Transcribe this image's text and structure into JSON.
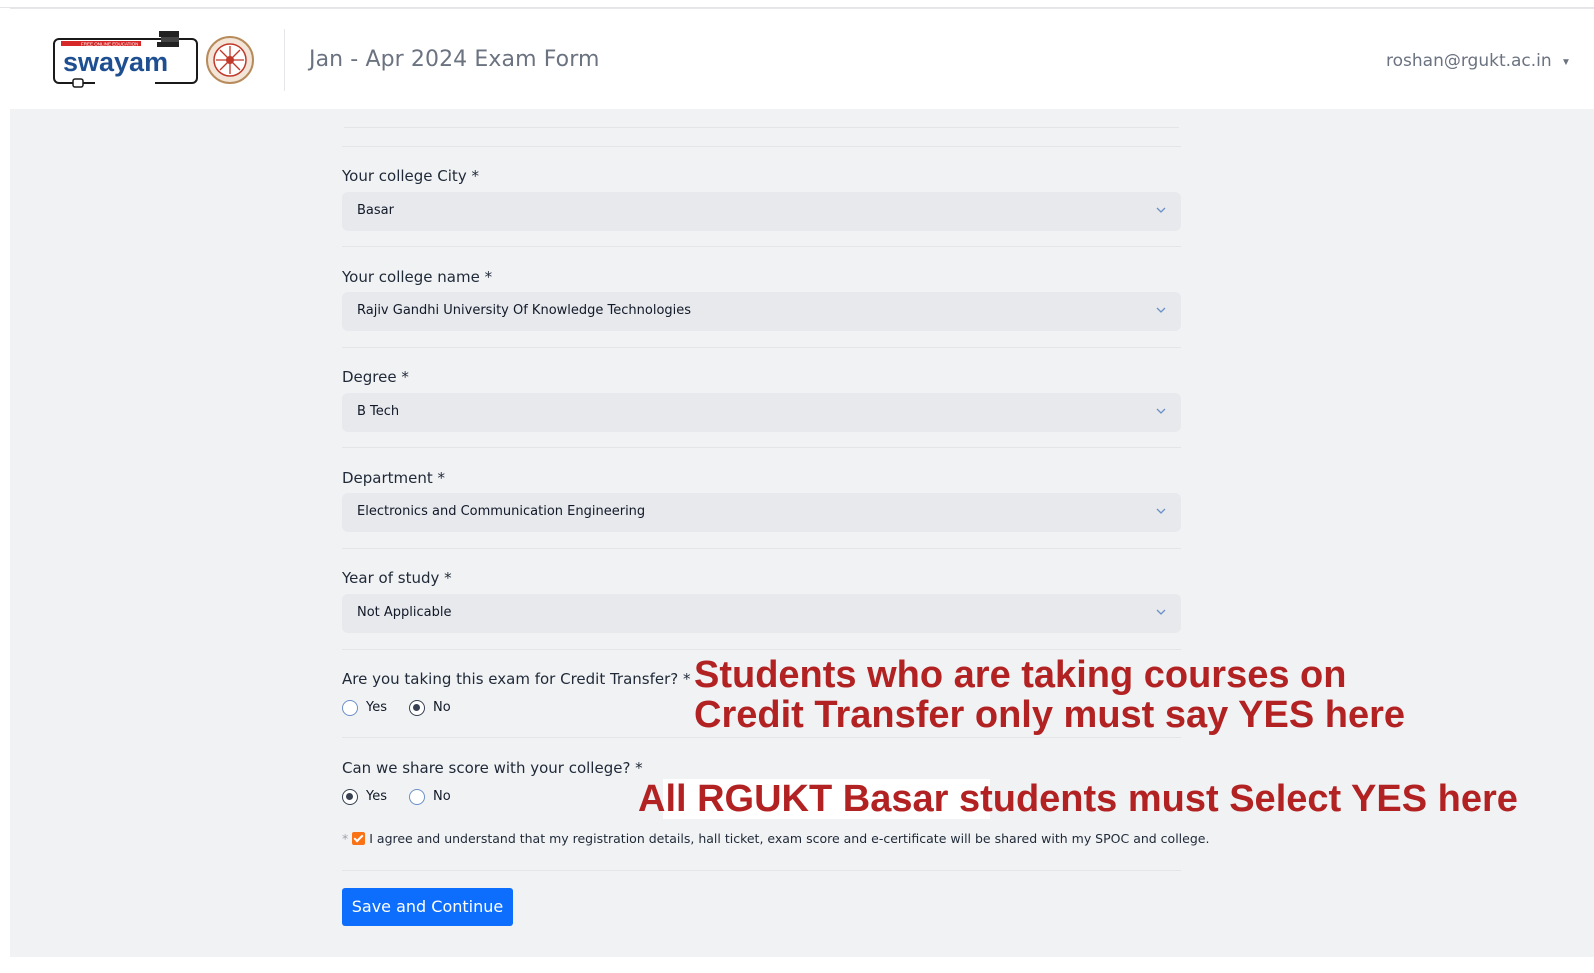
{
  "header": {
    "logo_text": "swayam",
    "title": "Jan - Apr 2024 Exam Form",
    "user_email": "roshan@rgukt.ac.in"
  },
  "form": {
    "city": {
      "label": "Your college City *",
      "value": "Basar"
    },
    "college": {
      "label": "Your college name *",
      "value": "Rajiv Gandhi University Of Knowledge Technologies"
    },
    "degree": {
      "label": "Degree *",
      "value": "B Tech"
    },
    "department": {
      "label": "Department *",
      "value": "Electronics and Communication Engineering"
    },
    "year": {
      "label": "Year of study *",
      "value": "Not Applicable"
    },
    "credit_transfer": {
      "label": "Are you taking this exam for Credit Transfer? *",
      "options": [
        "Yes",
        "No"
      ],
      "selected": "No"
    },
    "share_score": {
      "label": "Can we share score with your college? *",
      "options": [
        "Yes",
        "No"
      ],
      "selected": "Yes"
    },
    "agreement": {
      "star": "*",
      "text": "I agree and understand that my registration details, hall ticket, exam score and e-certificate will be shared with my SPOC and college.",
      "checked": true
    },
    "submit_label": "Save and Continue"
  },
  "annotations": {
    "credit_note_line1": "Students who are taking courses on",
    "credit_note_line2": "Credit Transfer only must say YES here",
    "share_note": "All RGUKT Basar students must Select YES here",
    "color": "#b22222"
  },
  "colors": {
    "primary_button": "#0d6efd",
    "checkbox": "#f97316",
    "page_bg": "#f1f2f4"
  }
}
